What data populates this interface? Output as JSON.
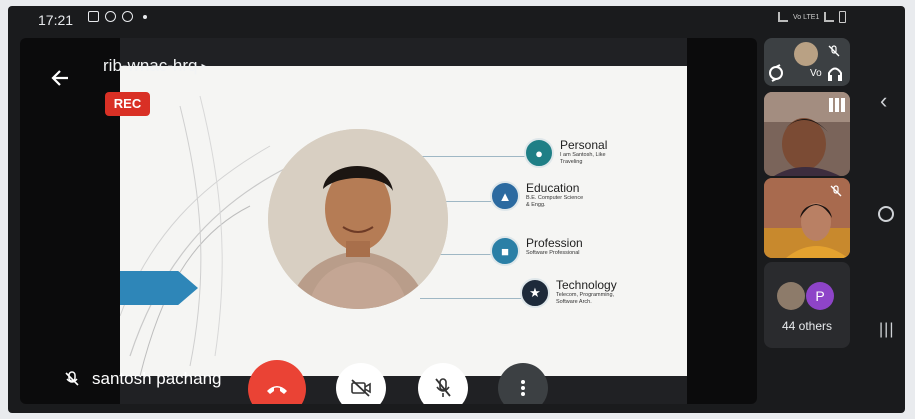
{
  "status_bar": {
    "time": "17:21",
    "network_label": "Vo LTE1"
  },
  "meeting": {
    "title": "rib-wnac-hrq",
    "rec_label": "REC",
    "presenter_name": "santosh pachang"
  },
  "slide": {
    "topics": [
      {
        "title": "Personal",
        "desc": "I am Santosh, Like Traveling",
        "icon": "person-icon"
      },
      {
        "title": "Education",
        "desc": "B.E. Computer Science & Engg.",
        "icon": "graduation-icon"
      },
      {
        "title": "Profession",
        "desc": "Software Professional",
        "icon": "briefcase-icon"
      },
      {
        "title": "Technology",
        "desc": "Telecom, Programming, Software Arch.",
        "icon": "skills-icon"
      }
    ]
  },
  "participants": {
    "others_count_label": "44 others",
    "avatar_letter": "P",
    "avatar_color": "#8e44c8"
  },
  "colors": {
    "end_call": "#ea4335",
    "rec": "#d93025",
    "accent_arrow": "#2e86b8",
    "topic_icon": "#1f7f86"
  }
}
